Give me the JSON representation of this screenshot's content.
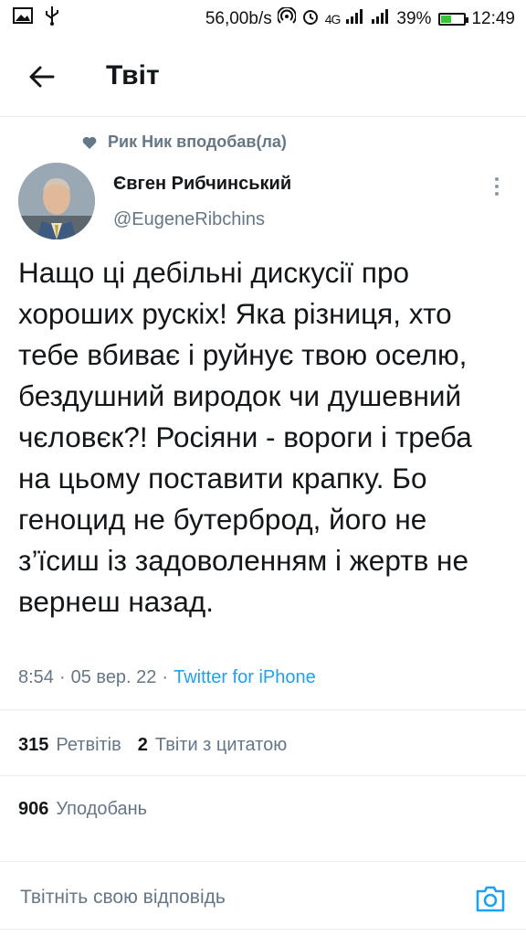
{
  "status_bar": {
    "network_speed": "56,00b/s",
    "network_type": "4G",
    "battery_percent": "39%",
    "battery_level": 0.39,
    "time": "12:49",
    "icons": [
      "image-icon",
      "usb-icon",
      "hotspot-icon",
      "alarm-icon",
      "signal-icon",
      "signal-icon",
      "battery-icon"
    ]
  },
  "header": {
    "title": "Твіт"
  },
  "social_context": {
    "text": "Рик Ник вподобав(ла)"
  },
  "author": {
    "name": "Євген Рибчинський",
    "handle": "@EugeneRibchins"
  },
  "tweet": {
    "text": "Нащо ці дебільні дискусії про хороших рускіх! Яка різниця, хто тебе вбиває і руйнує твою оселю, бездушний виродок чи душевний чєловєк?! Росіяни - вороги і треба на цьому поставити крапку. Бо геноцид не бутерброд, його не з’їсиш із задоволенням і жертв не вернеш назад.",
    "time": "8:54",
    "date": "05 вер. 22",
    "separator": "·",
    "source": "Twitter for iPhone"
  },
  "stats": {
    "retweets_count": "315",
    "retweets_label": "Ретвітів",
    "quotes_count": "2",
    "quotes_label": "Твіти з цитатою",
    "likes_count": "906",
    "likes_label": "Уподобань"
  },
  "reply": {
    "placeholder": "Твітніть свою відповідь"
  },
  "colors": {
    "accent": "#1da1f2",
    "secondary_text": "#657786",
    "primary_text": "#14171a",
    "divider": "#e6ecf0"
  }
}
